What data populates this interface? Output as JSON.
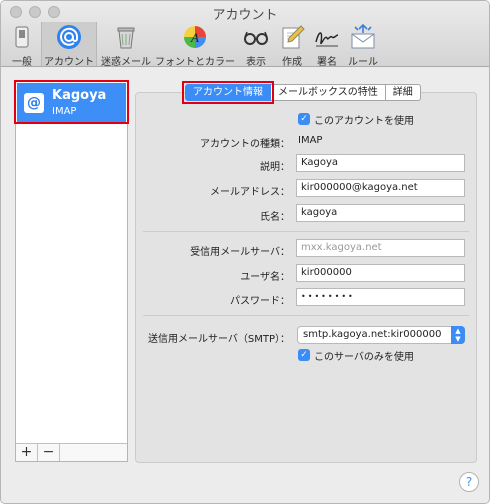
{
  "window": {
    "title": "アカウント"
  },
  "toolbar": {
    "items": [
      {
        "label": "一般",
        "icon": "switch-icon"
      },
      {
        "label": "アカウント",
        "icon": "at-sign-icon"
      },
      {
        "label": "迷惑メール",
        "icon": "trash-icon"
      },
      {
        "label": "フォントとカラー",
        "icon": "color-palette-icon"
      },
      {
        "label": "表示",
        "icon": "glasses-icon"
      },
      {
        "label": "作成",
        "icon": "pencil-icon"
      },
      {
        "label": "署名",
        "icon": "signature-icon"
      },
      {
        "label": "ルール",
        "icon": "rules-envelope-icon"
      }
    ],
    "selected": "アカウント"
  },
  "sidebar": {
    "accounts": [
      {
        "name": "Kagoya",
        "type": "IMAP"
      }
    ],
    "add_label": "+",
    "remove_label": "−"
  },
  "tabs": [
    {
      "label": "アカウント情報",
      "selected": true
    },
    {
      "label": "メールボックスの特性",
      "selected": false
    },
    {
      "label": "詳細",
      "selected": false
    }
  ],
  "form": {
    "enable_label": "このアカウントを使用",
    "enable_checked": true,
    "account_type_label": "アカウントの種類：",
    "account_type_value": "IMAP",
    "description_label": "説明：",
    "description_value": "Kagoya",
    "email_label": "メールアドレス：",
    "email_value": "kir000000@kagoya.net",
    "fullname_label": "氏名：",
    "fullname_value": "kagoya",
    "incoming_label": "受信用メールサーバ：",
    "incoming_value": "mxx.kagoya.net",
    "username_label": "ユーザ名：",
    "username_value": "kir000000",
    "password_label": "パスワード：",
    "password_value": "••••••••",
    "smtp_label": "送信用メールサーバ（SMTP）：",
    "smtp_value": "smtp.kagoya.net:kir000000",
    "smtp_only_label": "このサーバのみを使用",
    "smtp_only_checked": true
  },
  "help_label": "?",
  "colors": {
    "accent": "#3b8cf5",
    "highlight_box": "#e00012"
  }
}
